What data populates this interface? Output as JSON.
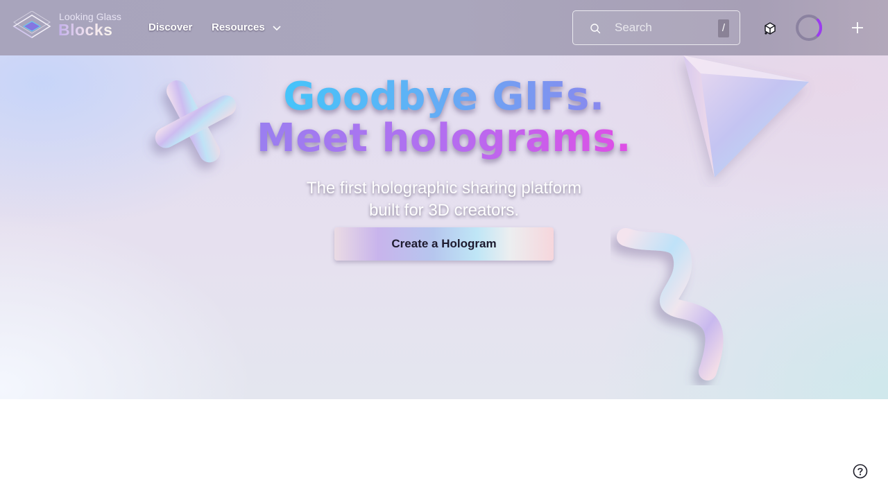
{
  "brand": {
    "name_small": "Looking Glass",
    "name_big": "Blocks"
  },
  "nav": {
    "discover": "Discover",
    "resources": "Resources"
  },
  "search": {
    "placeholder": "Search",
    "shortcut": "/"
  },
  "hero": {
    "headline_line1": "Goodbye GIFs.",
    "headline_line2": "Meet holograms.",
    "subtitle_line1": "The first holographic sharing platform",
    "subtitle_line2": "built for 3D creators.",
    "cta_label": "Create a Hologram"
  },
  "icons": {
    "logo": "looking-glass-logo-icon",
    "resources_dropdown": "chevron-down-icon",
    "search": "search-icon",
    "create": "cube-icon",
    "avatar": "loading-spinner-icon",
    "add": "plus-icon",
    "help": "help-icon"
  },
  "colors": {
    "headline_line1_gradient": [
      "#45c4fa",
      "#8a88ee"
    ],
    "headline_line2_gradient": [
      "#9a7ff0",
      "#df4ee6"
    ],
    "cta_text": "#1d1a2e",
    "avatar_ring": "#8b82a0",
    "avatar_accent": "#9b3cf0"
  }
}
